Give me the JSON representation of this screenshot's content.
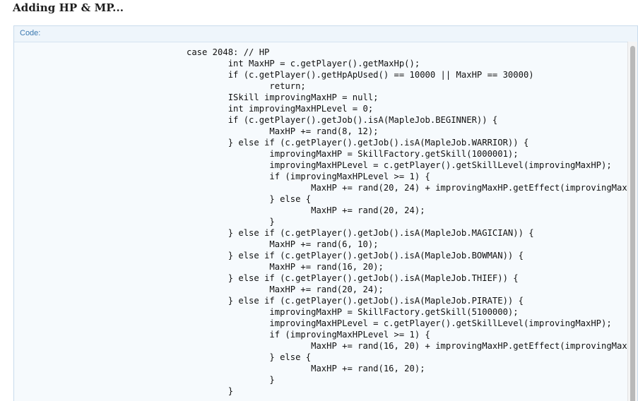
{
  "post": {
    "title": "Adding HP & MP..."
  },
  "code_block": {
    "label": "Code:",
    "content": "case 2048: // HP\n\tint MaxHP = c.getPlayer().getMaxHp();\n\tif (c.getPlayer().getHpApUsed() == 10000 || MaxHP == 30000)\n\t\treturn;\n\tISkill improvingMaxHP = null;\n\tint improvingMaxHPLevel = 0;\n\tif (c.getPlayer().getJob().isA(MapleJob.BEGINNER)) {\n\t\tMaxHP += rand(8, 12);\n\t} else if (c.getPlayer().getJob().isA(MapleJob.WARRIOR)) {\n\t\timprovingMaxHP = SkillFactory.getSkill(1000001);\n\t\timprovingMaxHPLevel = c.getPlayer().getSkillLevel(improvingMaxHP);\n\t\tif (improvingMaxHPLevel >= 1) {\n\t\t\tMaxHP += rand(20, 24) + improvingMaxHP.getEffect(improvingMax\n\t\t} else {\n\t\t\tMaxHP += rand(20, 24);\n\t\t}\n\t} else if (c.getPlayer().getJob().isA(MapleJob.MAGICIAN)) {\n\t\tMaxHP += rand(6, 10);\n\t} else if (c.getPlayer().getJob().isA(MapleJob.BOWMAN)) {\n\t\tMaxHP += rand(16, 20);\n\t} else if (c.getPlayer().getJob().isA(MapleJob.THIEF)) {\n\t\tMaxHP += rand(20, 24);\n\t} else if (c.getPlayer().getJob().isA(MapleJob.PIRATE)) {\n\t\timprovingMaxHP = SkillFactory.getSkill(5100000);\n\t\timprovingMaxHPLevel = c.getPlayer().getSkillLevel(improvingMaxHP);\n\t\tif (improvingMaxHPLevel >= 1) {\n\t\t\tMaxHP += rand(16, 20) + improvingMaxHP.getEffect(improvingMax\n\t\t} else {\n\t\t\tMaxHP += rand(16, 20);\n\t\t}\n\t}"
  }
}
